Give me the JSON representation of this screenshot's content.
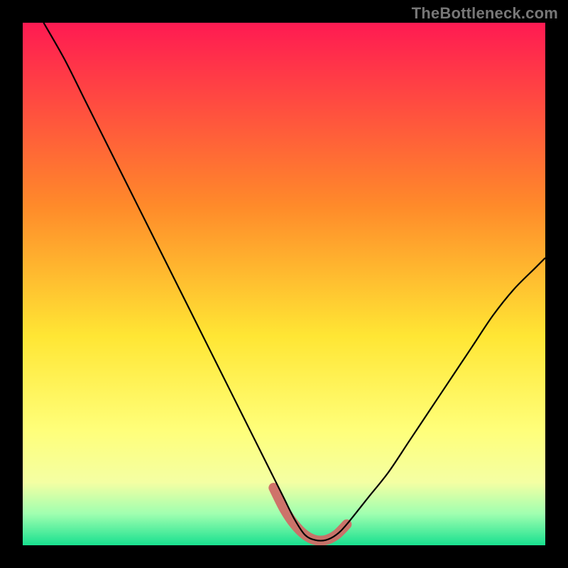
{
  "watermark": "TheBottleneck.com",
  "chart_data": {
    "type": "line",
    "title": "",
    "xlabel": "",
    "ylabel": "",
    "xlim": [
      0,
      100
    ],
    "ylim": [
      0,
      100
    ],
    "grid": false,
    "background_gradient_vertical": {
      "stops": [
        {
          "offset": 0,
          "color": "#ff1a52"
        },
        {
          "offset": 35,
          "color": "#ff8a2a"
        },
        {
          "offset": 60,
          "color": "#ffe634"
        },
        {
          "offset": 78,
          "color": "#ffff7a"
        },
        {
          "offset": 88,
          "color": "#f4ffa3"
        },
        {
          "offset": 94,
          "color": "#9fffb0"
        },
        {
          "offset": 100,
          "color": "#18e08f"
        }
      ]
    },
    "series": [
      {
        "name": "bottleneck-curve",
        "x": [
          4,
          8,
          12,
          16,
          20,
          24,
          28,
          32,
          36,
          40,
          44,
          48,
          50,
          52,
          54,
          56,
          58,
          60,
          62,
          66,
          70,
          74,
          78,
          82,
          86,
          90,
          94,
          98,
          100
        ],
        "y": [
          100,
          93,
          85,
          77,
          69,
          61,
          53,
          45,
          37,
          29,
          21,
          13,
          9,
          5,
          2,
          1,
          1,
          2,
          4,
          9,
          14,
          20,
          26,
          32,
          38,
          44,
          49,
          53,
          55
        ]
      }
    ],
    "highlight": {
      "name": "optimal-range",
      "x": [
        48,
        50,
        52,
        54,
        56,
        58,
        60,
        62
      ],
      "y": [
        11,
        7,
        4,
        2,
        1,
        1,
        2,
        4
      ]
    }
  }
}
